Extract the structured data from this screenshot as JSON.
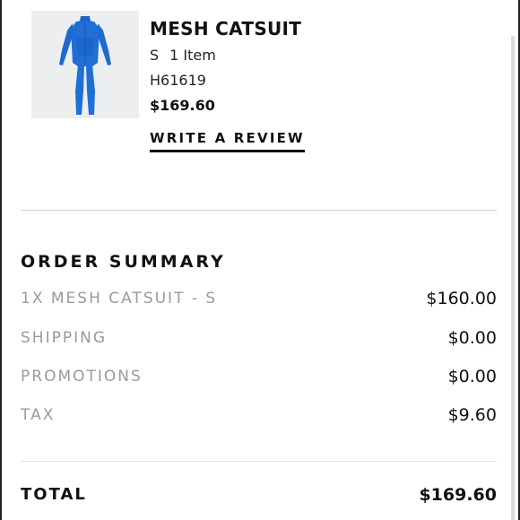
{
  "product": {
    "image_alt": "blue-catsuit",
    "name": "MESH CATSUIT",
    "size": "S",
    "quantity": "1 Item",
    "sku": "H61619",
    "price": "$169.60",
    "review_label": "WRITE A REVIEW",
    "colors": {
      "catsuit": "#1f6fd6",
      "thumb_bg": "#eceef0"
    }
  },
  "order_summary": {
    "title": "ORDER SUMMARY",
    "rows": [
      {
        "label": "1X MESH CATSUIT - S",
        "value": "$160.00"
      },
      {
        "label": "SHIPPING",
        "value": "$0.00"
      },
      {
        "label": "PROMOTIONS",
        "value": "$0.00"
      },
      {
        "label": "TAX",
        "value": "$9.60"
      }
    ],
    "total_label": "TOTAL",
    "total_value": "$169.60"
  }
}
